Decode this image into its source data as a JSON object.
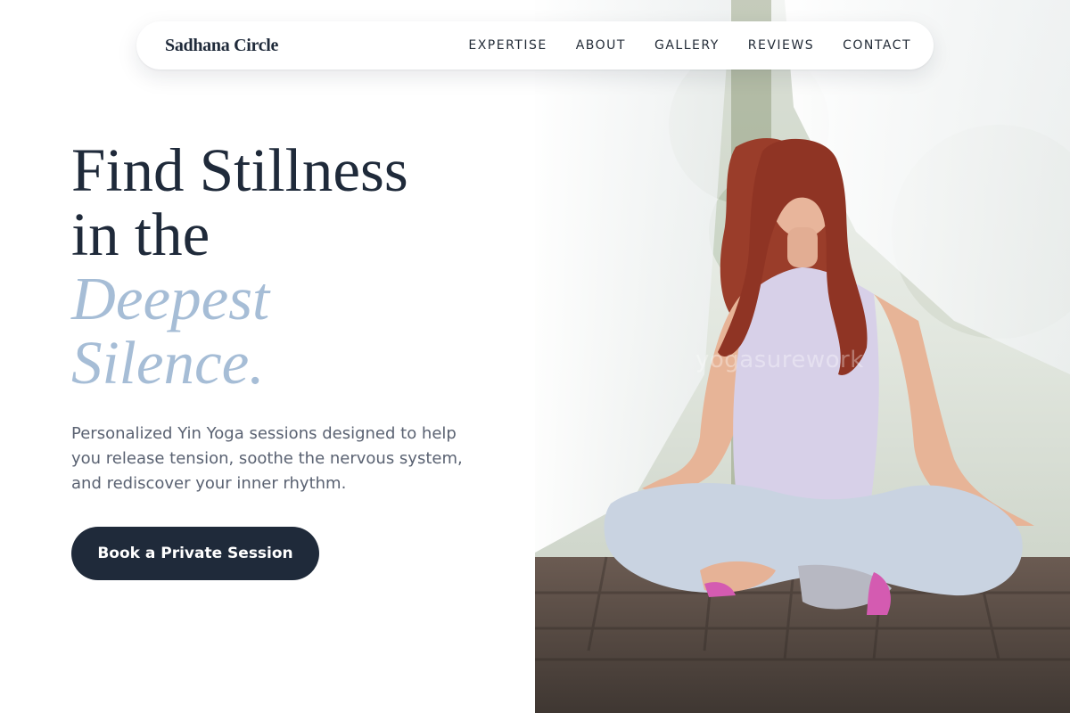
{
  "nav": {
    "brand": "Sadhana Circle",
    "links": [
      {
        "label": "EXPERTISE"
      },
      {
        "label": "ABOUT"
      },
      {
        "label": "GALLERY"
      },
      {
        "label": "REVIEWS"
      },
      {
        "label": "CONTACT"
      }
    ]
  },
  "hero": {
    "headline_line1": "Find Stillness",
    "headline_line2": "in the",
    "headline_accent1": "Deepest",
    "headline_accent2": "Silence.",
    "description": "Personalized Yin Yoga sessions designed to help you release tension, soothe the nervous system, and rediscover your inner rhythm.",
    "cta_label": "Book a Private Session"
  },
  "image": {
    "watermark": "yogasurework",
    "subject": "woman meditating in lotus pose on wooden deck"
  },
  "colors": {
    "primary": "#1f2a3a",
    "accent": "#a6bdd6",
    "body_text": "#5a6272"
  }
}
